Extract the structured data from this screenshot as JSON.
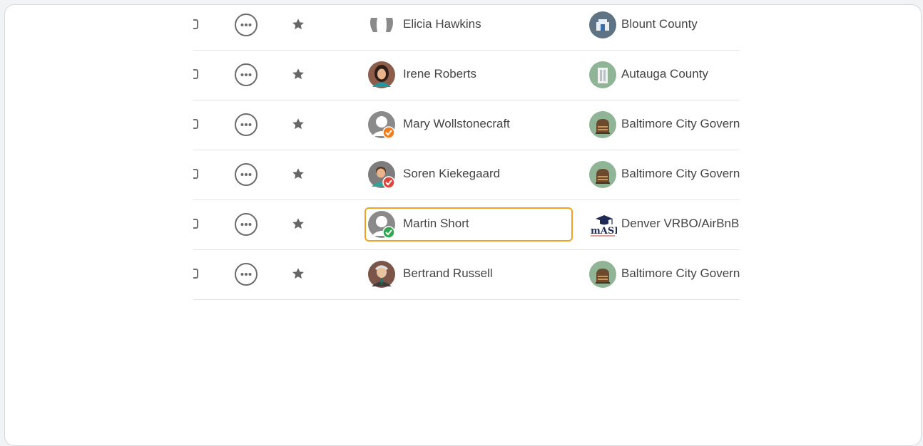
{
  "rows": [
    {
      "name": "Elicia Hawkins",
      "org": "Blount County"
    },
    {
      "name": "Irene Roberts",
      "org": "Autauga County"
    },
    {
      "name": "Mary Wollstonecraft",
      "org": "Baltimore City Government"
    },
    {
      "name": "Soren Kiekegaard",
      "org": "Baltimore City Government"
    },
    {
      "name": "Martin Short",
      "org": "Denver VRBO/AirBnB Audit",
      "focused": true,
      "logo_text": "mASD"
    },
    {
      "name": "Bertrand Russell",
      "org": "Baltimore City Government"
    }
  ],
  "colors": {
    "focus_border": "#f0a31e",
    "badge_orange": "#f07f1b",
    "badge_red": "#e0453a",
    "badge_green": "#2fa84f",
    "org_circle_green": "#8fb496",
    "org_circle_slate": "#5e7383"
  },
  "icons": {
    "more": "more-horizontal-circle-icon",
    "star": "star-icon",
    "checkbox": "checkbox-icon"
  }
}
